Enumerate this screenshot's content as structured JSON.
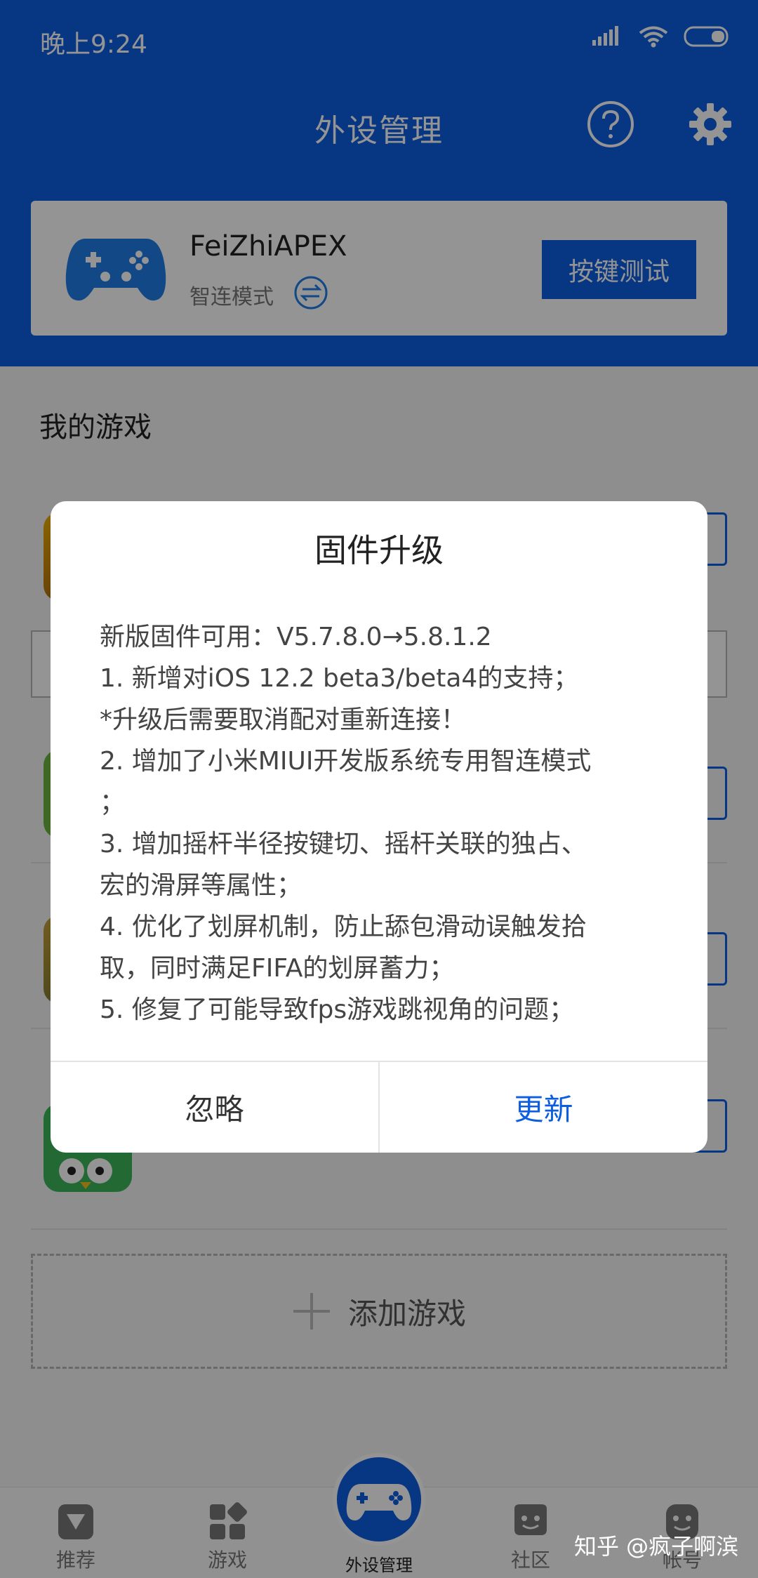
{
  "status_bar": {
    "time": "晚上9:24",
    "icons": [
      "signal-icon",
      "wifi-icon",
      "battery-icon"
    ]
  },
  "app_bar": {
    "title": "外设管理",
    "icons": [
      "help-icon",
      "settings-icon"
    ]
  },
  "device": {
    "name": "FeiZhiAPEX",
    "mode": "智连模式",
    "test_button": "按键测试",
    "icons": [
      "gamepad-icon",
      "switch-mode-icon"
    ]
  },
  "my_games": {
    "title": "我的游戏",
    "add_label": "添加游戏"
  },
  "bottom_nav": {
    "items": [
      {
        "label": "推荐",
        "icon": "recommend-icon"
      },
      {
        "label": "游戏",
        "icon": "games-icon"
      },
      {
        "label": "外设管理",
        "icon": "gamepad-icon"
      },
      {
        "label": "社区",
        "icon": "community-icon"
      },
      {
        "label": "帐号",
        "icon": "account-icon"
      }
    ]
  },
  "watermark": "知乎 @疯子啊滨",
  "dialog": {
    "title": "固件升级",
    "lines": [
      "新版固件可用：V5.7.8.0→5.8.1.2",
      "1. 新增对iOS 12.2 beta3/beta4的支持；",
      "*升级后需要取消配对重新连接！",
      "2. 增加了小米MIUI开发版系统专用智连模式",
      "；",
      "3. 增加摇杆半径按键切、摇杆关联的独占、",
      "宏的滑屏等属性；",
      "4. 优化了划屏机制，防止舔包滑动误触发拾",
      "取，同时满足FIFA的划屏蓄力；",
      "5. 修复了可能导致fps游戏跳视角的问题；"
    ],
    "ignore_label": "忽略",
    "update_label": "更新"
  },
  "colors": {
    "primary": "#0d5de0",
    "overlay": "rgba(0,0,0,0.42)"
  }
}
